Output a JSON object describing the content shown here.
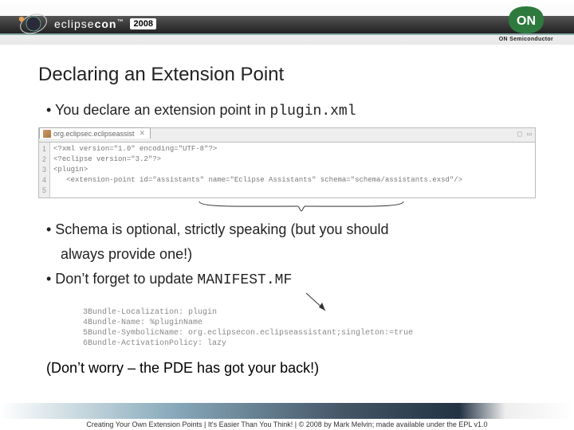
{
  "header": {
    "brand_lead": "eclipse",
    "brand_tail": "CON",
    "tm": "™",
    "year": "2008",
    "sponsor_name": "ON",
    "sponsor_sub": "ON Semiconductor"
  },
  "title": "Declaring an Extension Point",
  "bullet1_prefix": "• You declare an extension point in ",
  "bullet1_code": "plugin.xml",
  "editor": {
    "tab_label": "org.eclipsec.eclipseassist",
    "toolbar_icons": "▢ ▭",
    "gutter": [
      "1",
      "2",
      "3",
      "4",
      "5"
    ],
    "lines_plain": "<?xml version=\"1.0\" encoding=\"UTF-8\"?>\n<?eclipse version=\"3.2\"?>\n<plugin>\n   <extension-point id=\"assistants\" name=\"Eclipse Assistants\" schema=\"schema/assistants.exsd\"/>\n"
  },
  "bullet2": "• Schema is optional, strictly speaking (but you should",
  "bullet2b": "always provide one!)",
  "bullet3_prefix": "• Don’t forget to update ",
  "bullet3_code": "MANIFEST.MF",
  "manifest_block": "3Bundle-Localization: plugin\n4Bundle-Name: %pluginName\n5Bundle-SymbolicName: org.eclipsecon.eclipseassistant;singleton:=true\n6Bundle-ActivationPolicy: lazy",
  "closing": "(Don’t worry – the PDE has got your back!)",
  "footer": "Creating Your Own Extension Points  |  It's Easier Than You Think!  |  © 2008 by Mark Melvin; made available under the EPL v1.0"
}
